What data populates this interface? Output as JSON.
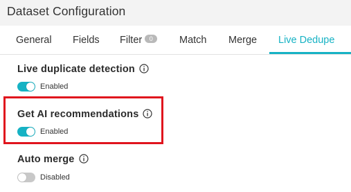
{
  "header": {
    "title": "Dataset Configuration"
  },
  "tabs": [
    {
      "label": "General"
    },
    {
      "label": "Fields"
    },
    {
      "label": "Filter",
      "badge": "0"
    },
    {
      "label": "Match"
    },
    {
      "label": "Merge"
    },
    {
      "label": "Live Dedupe",
      "active": true
    }
  ],
  "settings": [
    {
      "title": "Live duplicate detection",
      "state": "Enabled",
      "on": true
    },
    {
      "title": "Get AI recommendations",
      "state": "Enabled",
      "on": true
    },
    {
      "title": "Auto merge",
      "state": "Disabled",
      "on": false
    }
  ],
  "colors": {
    "accent": "#16b2c4",
    "highlight": "#e0141d",
    "toggle_off": "#c8c8c8"
  },
  "icons": {
    "info": "info-circle-icon"
  }
}
